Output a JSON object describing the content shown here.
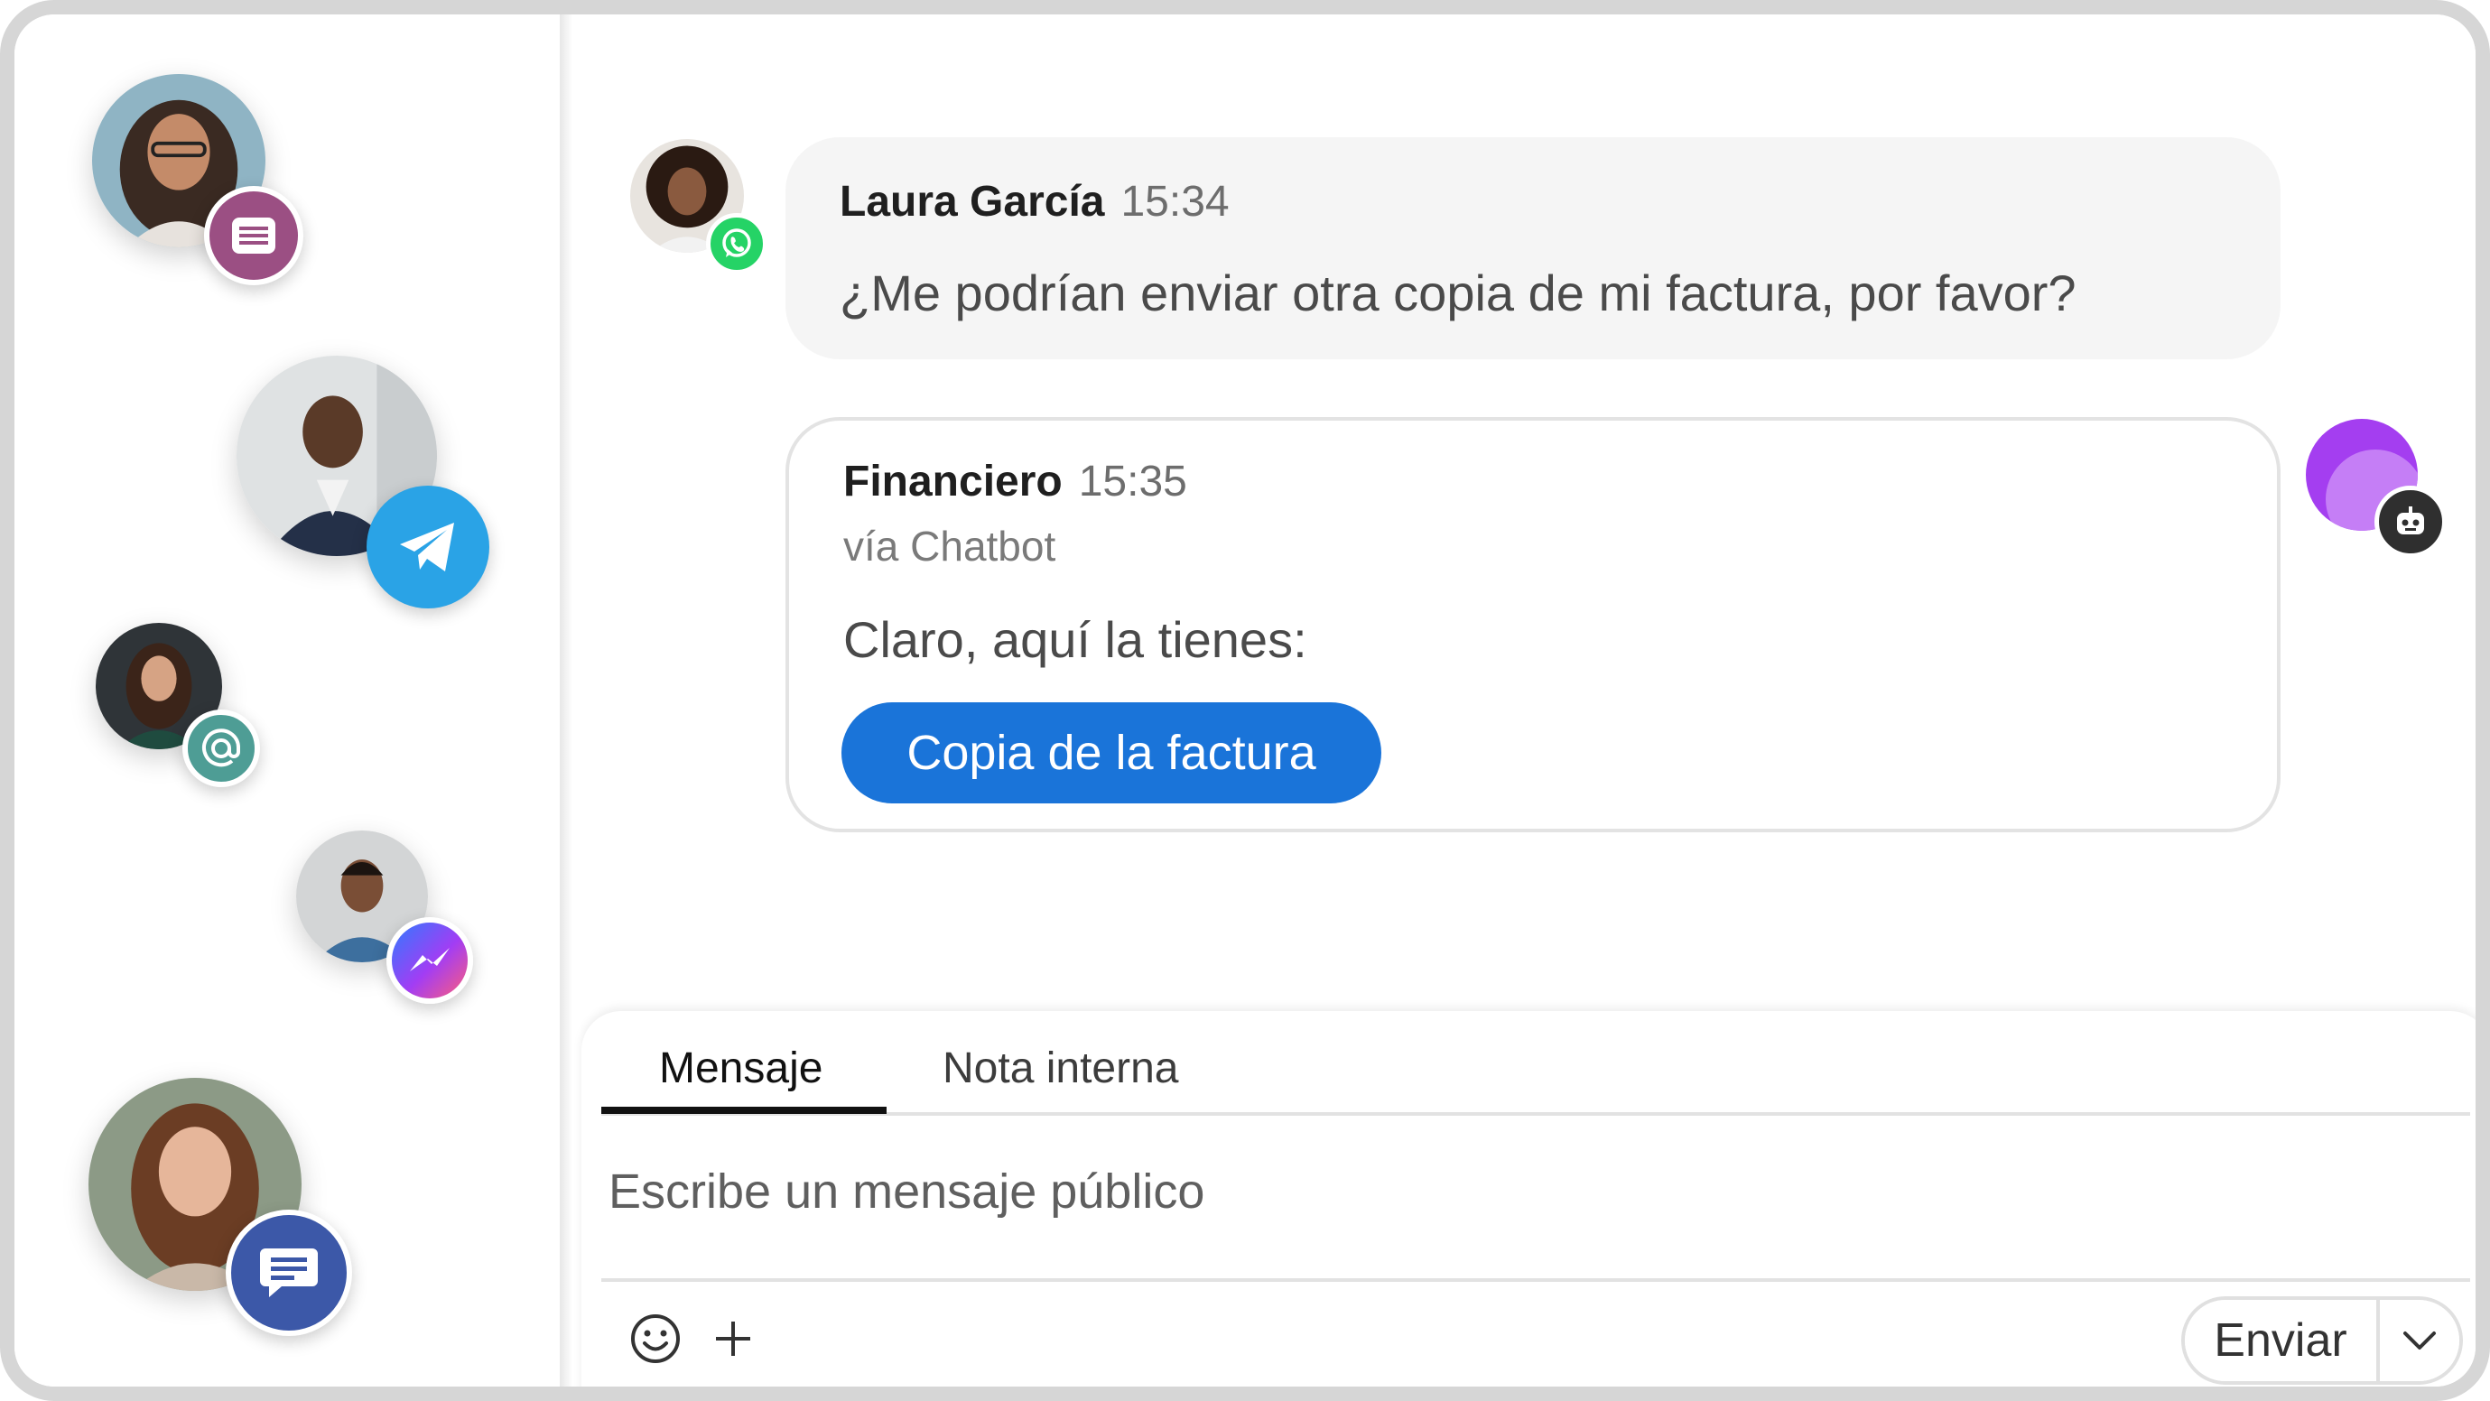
{
  "colors": {
    "primary_button": "#1a74d9",
    "whatsapp": "#25d366",
    "telegram": "#2aa3e6",
    "email_badge": "#4e9d95",
    "sms_badge": "#9b4f83",
    "chat_badge": "#3c58a8",
    "bot_avatar": "#a43ef0"
  },
  "contacts": [
    {
      "channel": "sms",
      "badge_icon": "message-lines-icon"
    },
    {
      "channel": "telegram",
      "badge_icon": "telegram-plane-icon"
    },
    {
      "channel": "email",
      "badge_icon": "at-sign-icon"
    },
    {
      "channel": "messenger",
      "badge_icon": "messenger-bolt-icon"
    },
    {
      "channel": "webchat",
      "badge_icon": "chat-bubble-icon"
    }
  ],
  "conversation": {
    "incoming": {
      "sender": "Laura García",
      "time": "15:34",
      "text": "¿Me podrían enviar otra copia de mi factura, por favor?",
      "channel_icon": "whatsapp-icon"
    },
    "outgoing": {
      "sender": "Financiero",
      "time": "15:35",
      "via": "vía Chatbot",
      "text": "Claro, aquí la tienes:",
      "button_label": "Copia de la factura",
      "avatar_icon": "robot-icon"
    }
  },
  "composer": {
    "tabs": [
      {
        "label": "Mensaje",
        "active": true
      },
      {
        "label": "Nota interna",
        "active": false
      }
    ],
    "placeholder": "Escribe un mensaje público",
    "send_label": "Enviar"
  }
}
